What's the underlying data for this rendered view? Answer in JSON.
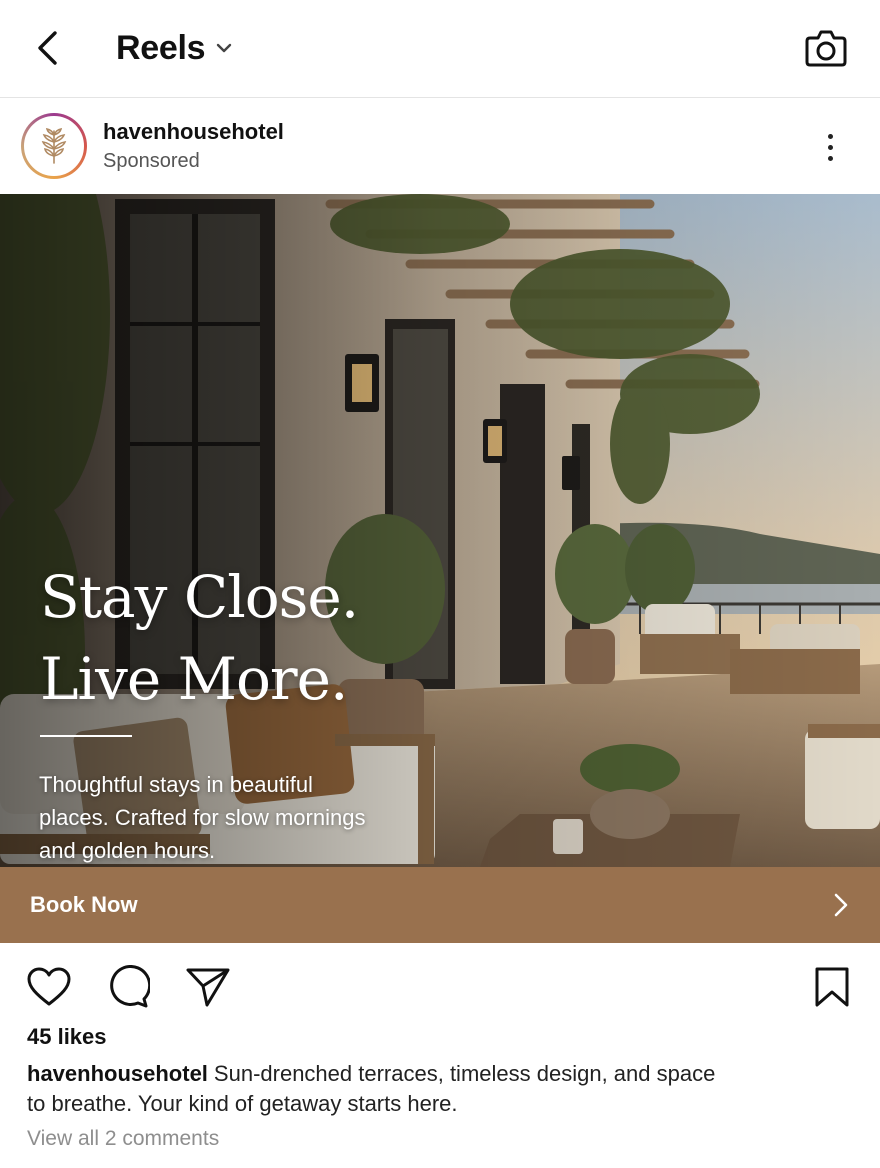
{
  "header": {
    "title": "Reels",
    "icons": {
      "back": "chevron-left-icon",
      "dropdown": "chevron-down-icon",
      "camera": "camera-icon"
    }
  },
  "post": {
    "username": "havenhousehotel",
    "label": "Sponsored",
    "avatar_icon": "leaf-logo-icon",
    "more_icon": "more-vertical-icon"
  },
  "media": {
    "headline_line1": "Stay Close.",
    "headline_line2": "Live More.",
    "subtext": "Thoughtful stays in beautiful places. Crafted for slow mornings and golden hours.",
    "description": "photo-terrace-at-sunset"
  },
  "cta": {
    "label": "Book Now",
    "icon": "chevron-right-icon",
    "color": "#99714e"
  },
  "actions": {
    "like": "heart-icon",
    "comment": "comment-icon",
    "share": "paper-plane-icon",
    "save": "bookmark-icon"
  },
  "engagement": {
    "likes": "45 likes",
    "caption_user": "havenhousehotel",
    "caption_text": "Sun-drenched terraces, timeless design, and space to breathe. Your kind of getaway starts here.",
    "comments_link": "View all 2 comments"
  }
}
